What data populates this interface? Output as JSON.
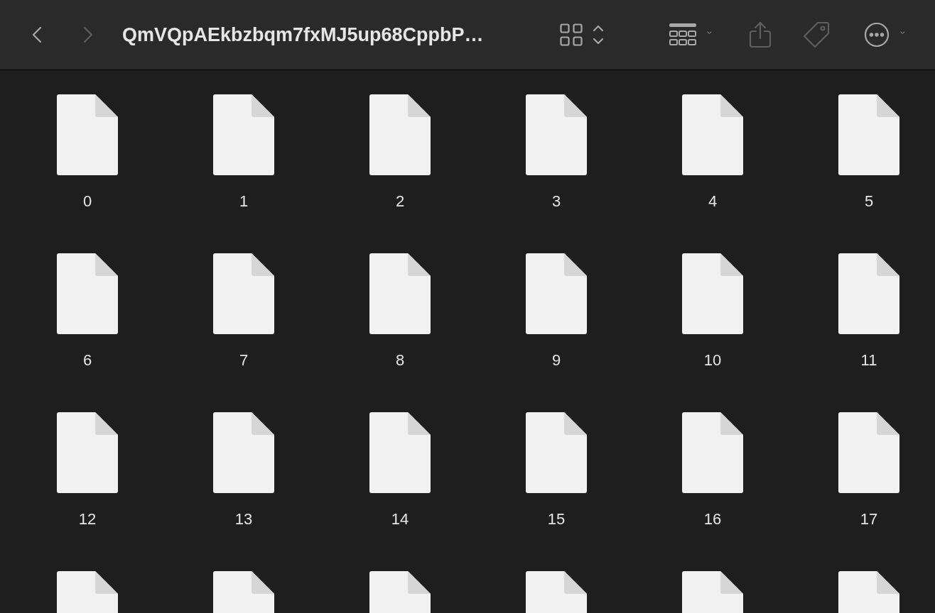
{
  "toolbar": {
    "back": {
      "disabled": false
    },
    "forward": {
      "disabled": true
    },
    "title": "QmVQpAEkbzbqm7fxMJ5up68CppbP…",
    "share": {
      "disabled": true
    },
    "tags": {
      "disabled": true
    }
  },
  "files": [
    {
      "kind": "document",
      "name": "0"
    },
    {
      "kind": "document",
      "name": "1"
    },
    {
      "kind": "document",
      "name": "2"
    },
    {
      "kind": "document",
      "name": "3"
    },
    {
      "kind": "document",
      "name": "4"
    },
    {
      "kind": "document",
      "name": "5"
    },
    {
      "kind": "document",
      "name": "6"
    },
    {
      "kind": "document",
      "name": "7"
    },
    {
      "kind": "document",
      "name": "8"
    },
    {
      "kind": "document",
      "name": "9"
    },
    {
      "kind": "document",
      "name": "10"
    },
    {
      "kind": "document",
      "name": "11"
    },
    {
      "kind": "document",
      "name": "12"
    },
    {
      "kind": "document",
      "name": "13"
    },
    {
      "kind": "document",
      "name": "14"
    },
    {
      "kind": "document",
      "name": "15"
    },
    {
      "kind": "document",
      "name": "16"
    },
    {
      "kind": "document",
      "name": "17"
    },
    {
      "kind": "document"
    },
    {
      "kind": "document"
    },
    {
      "kind": "document"
    },
    {
      "kind": "document"
    },
    {
      "kind": "document"
    },
    {
      "kind": "document"
    }
  ]
}
